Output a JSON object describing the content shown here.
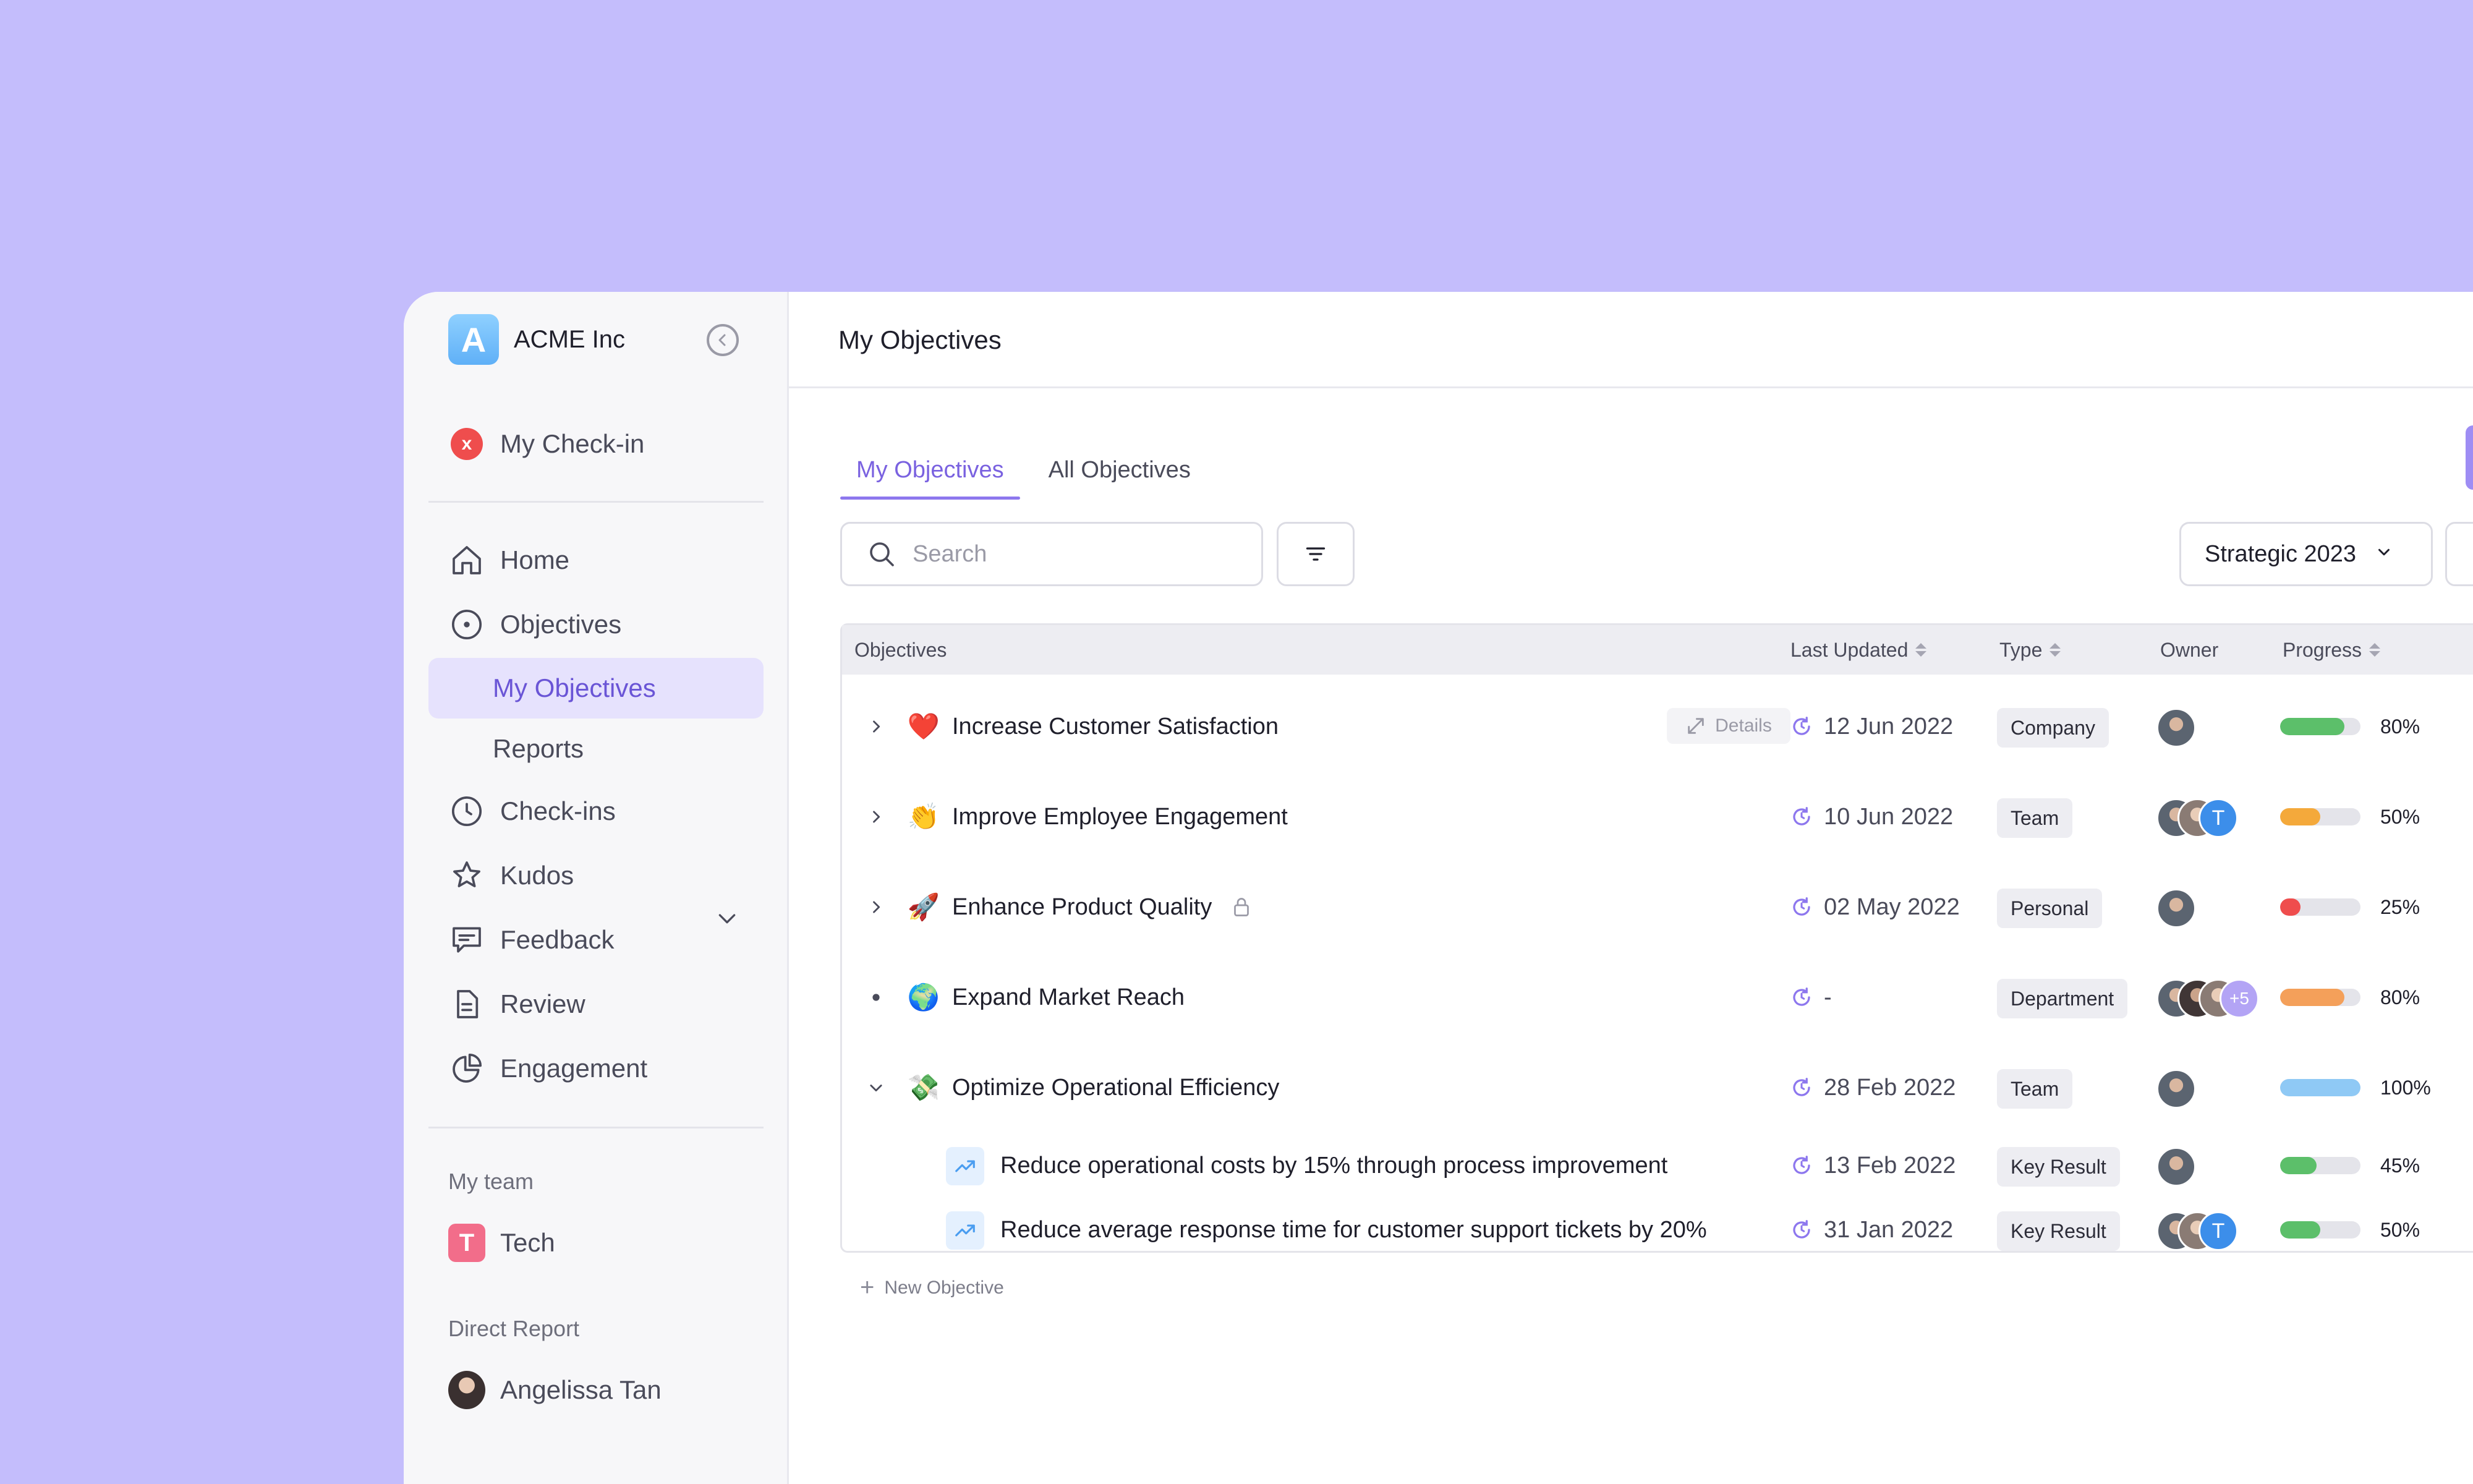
{
  "app": {
    "name": "ACME Inc",
    "logo_letter": "A"
  },
  "sidebar": {
    "checkin": {
      "label": "My Check-in",
      "status": "x"
    },
    "items": [
      {
        "key": "home",
        "label": "Home",
        "icon": "home-icon"
      },
      {
        "key": "objectives",
        "label": "Objectives",
        "icon": "target-icon",
        "expanded": true
      },
      {
        "key": "checkins",
        "label": "Check-ins",
        "icon": "clock-icon"
      },
      {
        "key": "kudos",
        "label": "Kudos",
        "icon": "star-icon"
      },
      {
        "key": "feedback",
        "label": "Feedback",
        "icon": "chat-icon"
      },
      {
        "key": "review",
        "label": "Review",
        "icon": "document-icon"
      },
      {
        "key": "engagement",
        "label": "Engagement",
        "icon": "pie-chart-icon"
      }
    ],
    "objectives_sub": [
      {
        "label": "My Objectives",
        "active": true
      },
      {
        "label": "Reports",
        "active": false
      }
    ],
    "my_team": {
      "title": "My team",
      "team": {
        "letter": "T",
        "name": "Tech"
      }
    },
    "direct_report": {
      "title": "Direct Report",
      "person": "Angelissa Tan"
    }
  },
  "header": {
    "title": "My Objectives"
  },
  "tabs": [
    {
      "label": "My Objectives",
      "active": true
    },
    {
      "label": "All Objectives",
      "active": false
    }
  ],
  "toolbar": {
    "search_placeholder": "Search",
    "period": "Strategic 2023"
  },
  "table": {
    "columns": {
      "objectives": "Objectives",
      "last_updated": "Last Updated",
      "type": "Type",
      "owner": "Owner",
      "progress": "Progress"
    },
    "details_label": "Details",
    "rows": [
      {
        "emoji": "❤️",
        "name": "Increase Customer Satisfaction",
        "updated": "12 Jun 2022",
        "type": "Company",
        "progress": 80,
        "progress_label": "80%",
        "bar_color": "#5cbf6a"
      },
      {
        "emoji": "👏",
        "name": "Improve Employee Engagement",
        "updated": "10 Jun 2022",
        "type": "Team",
        "progress": 50,
        "progress_label": "50%",
        "bar_color": "#f4a93b",
        "owner_more": "T"
      },
      {
        "emoji": "🚀",
        "name": "Enhance Product Quality",
        "updated": "02 May 2022",
        "type": "Personal",
        "progress": 25,
        "progress_label": "25%",
        "bar_color": "#ef4d4d",
        "locked": true
      },
      {
        "emoji": "🌍",
        "name": "Expand Market Reach",
        "updated": "-",
        "type": "Department",
        "progress": 80,
        "progress_label": "80%",
        "bar_color": "#f4a05a",
        "owner_more": "+5"
      },
      {
        "emoji": "💸",
        "name": "Optimize Operational Efficiency",
        "updated": "28 Feb 2022",
        "type": "Team",
        "progress": 100,
        "progress_label": "100%",
        "bar_color": "#8fc9f5"
      }
    ],
    "key_results": [
      {
        "name": "Reduce operational costs by 15% through process improvement",
        "updated": "13 Feb 2022",
        "type": "Key Result",
        "progress": 45,
        "progress_label": "45%",
        "bar_color": "#5cbf6a"
      },
      {
        "name": "Reduce average response time for customer support tickets by 20%",
        "updated": "31 Jan 2022",
        "type": "Key Result",
        "progress": 50,
        "progress_label": "50%",
        "bar_color": "#5cbf6a",
        "owner_more": "T"
      }
    ],
    "new_objective_label": "New Objective"
  },
  "colors": {
    "accent": "#7a62e0",
    "background": "#c4bdfc"
  }
}
